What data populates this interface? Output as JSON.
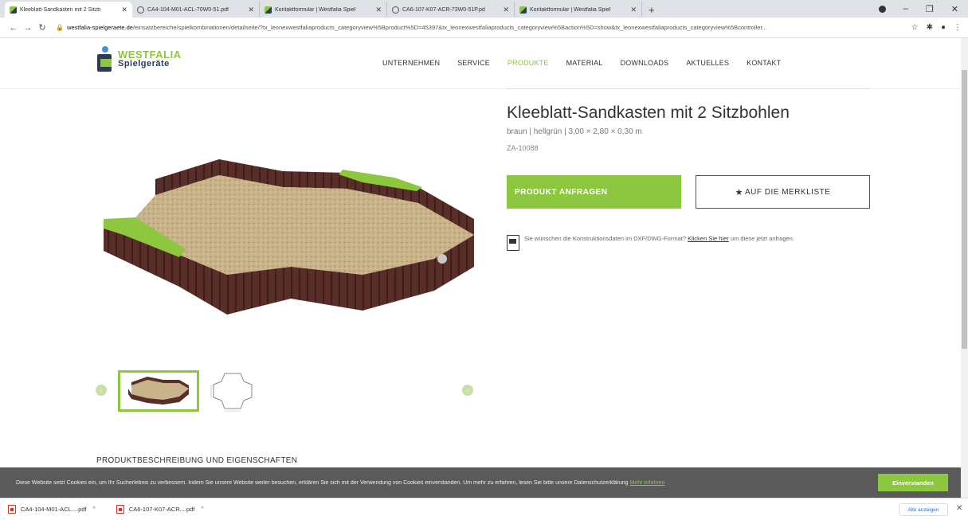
{
  "browser": {
    "tabs": [
      {
        "title": "Kleeblatt-Sandkasten mit 2 Sitzb",
        "icon": "westfalia-favicon",
        "active": true
      },
      {
        "title": "CA4-104-M01-ACL-70W0-51.pdf",
        "icon": "globe-icon",
        "active": false
      },
      {
        "title": "Kontaktformular | Westfalia Spiel",
        "icon": "westfalia-favicon",
        "active": false
      },
      {
        "title": "CA6-107-K07-ACR-73W0-51P.pd",
        "icon": "globe-icon",
        "active": false
      },
      {
        "title": "Kontaktformular | Westfalia Spiel",
        "icon": "westfalia-favicon",
        "active": false
      }
    ],
    "url_host": "westfalia-spielgeraete.de",
    "url_path": "/einsatzbereiche/spielkombinationen/detailseite/?tx_leonexwestfaliaproducts_categoryview%5Bproduct%5D=45397&tx_leonexwestfaliaproducts_categoryview%5Baction%5D=show&tx_leonexwestfaliaproducts_categoryview%5Bcontroller..."
  },
  "site": {
    "logo_line1": "WESTFALIA",
    "logo_line2": "Spielgeräte",
    "nav": [
      "UNTERNEHMEN",
      "SERVICE",
      "PRODUKTE",
      "MATERIAL",
      "DOWNLOADS",
      "AKTUELLES",
      "KONTAKT"
    ],
    "nav_active": "PRODUKTE",
    "brand_green": "#8dc63f",
    "brand_navy": "#2b3b5c"
  },
  "product": {
    "title": "Kleeblatt-Sandkasten mit 2 Sitzbohlen",
    "subtitle": "braun | hellgrün | 3,00 × 2,80 × 0,30 m",
    "sku": "ZA-10088",
    "request_label": "PRODUKT ANFRAGEN",
    "wishlist_label": "AUF DIE MERKLISTE",
    "dxf_text_before": "Sie wünschen die Konstruktionsdaten im DXF/DWG-Format? ",
    "dxf_link": "Klicken Sie hier",
    "dxf_text_after": " um diese jetzt anfragen.",
    "section_heading": "PRODUKTBESCHREIBUNG UND EIGENSCHAFTEN"
  },
  "cookie": {
    "text": "Diese Website setzt Cookies ein, um Ihr Sucherlebnis zu verbessern. Indem Sie unsere Website weiter besuchen, erklären Sie sich mit der Verwendung von Cookies einverstanden. Um mehr zu erfahren, lesen Sie bitte unsere Datenschutzerklärung ",
    "link": "Mehr erfahren",
    "accept": "Einverstanden"
  },
  "downloads": {
    "items": [
      "CA4-104-M01-ACL....pdf",
      "CA6-107-K07-ACR....pdf"
    ],
    "show_all": "Alle anzeigen"
  }
}
